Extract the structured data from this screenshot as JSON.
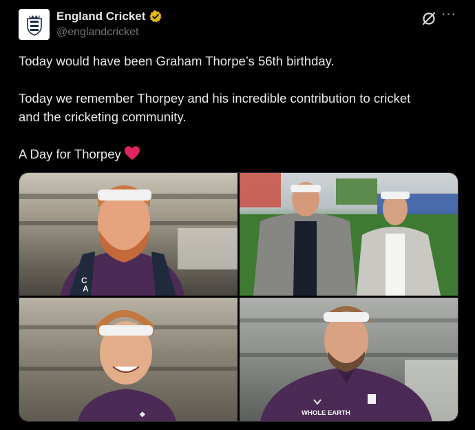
{
  "account": {
    "display_name": "England Cricket",
    "handle": "@englandcricket",
    "verified_badge": "gold-verified-badge",
    "avatar": "three-lions-crest"
  },
  "actions": {
    "grok_icon": "grok-icon",
    "more_icon": "more-options-icon",
    "more_glyph": "···"
  },
  "tweet": {
    "line1": "Today would have been Graham Thorpe’s 56th birthday.",
    "line2": "Today we remember Thorpey and his incredible contribution to cricket",
    "line3": "and the cricketing community.",
    "line4": "A Day for Thorpey",
    "emoji": "red-heart"
  },
  "media": {
    "photos": [
      {
        "subject": "player with white headband and ginger beard"
      },
      {
        "subject": "two men in blazers with headbands at the ground"
      },
      {
        "subject": "player with white headband smiling"
      },
      {
        "subject": "player with white headband in team jacket"
      }
    ],
    "shirt_text": "WHOLE EARTH",
    "bag_text": "C A"
  },
  "colors": {
    "background": "#000000",
    "text": "#e7e9ea",
    "secondary": "#71767b",
    "heart": "#f91880",
    "verified": "#e2b719",
    "jacket": "#4b2a56"
  }
}
